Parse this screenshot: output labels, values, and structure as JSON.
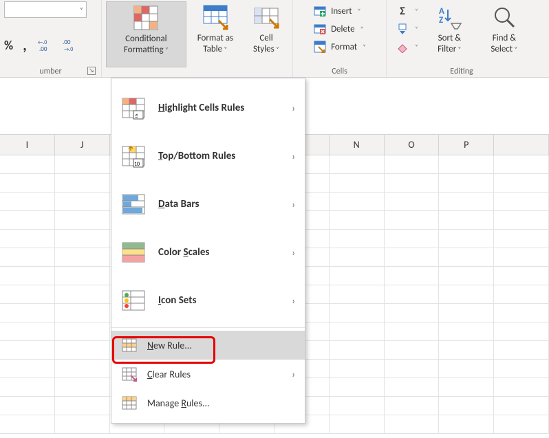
{
  "ribbon": {
    "number_group": {
      "label": "umber",
      "percent": "%",
      "comma": ",",
      "inc_decimal": "←.0\n.00",
      "dec_decimal": ".00\n→.0"
    },
    "styles_group": {
      "conditional_formatting": "Conditional Formatting",
      "format_as_table": "Format as Table",
      "cell_styles": "Cell Styles"
    },
    "cells_group": {
      "label": "Cells",
      "insert": "Insert",
      "delete": "Delete",
      "format": "Format"
    },
    "editing_group": {
      "label": "Editing",
      "autosum": "Σ",
      "fill": "⬇",
      "clear": "◇",
      "sort_filter": "Sort & Filter",
      "find_select": "Find & Select"
    }
  },
  "menu": {
    "highlight_cells_rules": "Highlight Cells Rules",
    "top_bottom_rules": "Top/Bottom Rules",
    "data_bars": "Data Bars",
    "color_scales": "Color Scales",
    "icon_sets": "Icon Sets",
    "new_rule": "New Rule...",
    "clear_rules": "Clear Rules",
    "manage_rules": "Manage Rules..."
  },
  "menu_underline": {
    "highlight_cells_rules": "H",
    "top_bottom_rules": "T",
    "data_bars": "D",
    "color_scales": "S",
    "icon_sets": "I",
    "new_rule": "N",
    "clear_rules": "C",
    "manage_rules": "R"
  },
  "columns": [
    "I",
    "J",
    "",
    "",
    "",
    "",
    "N",
    "O",
    "P",
    ""
  ]
}
